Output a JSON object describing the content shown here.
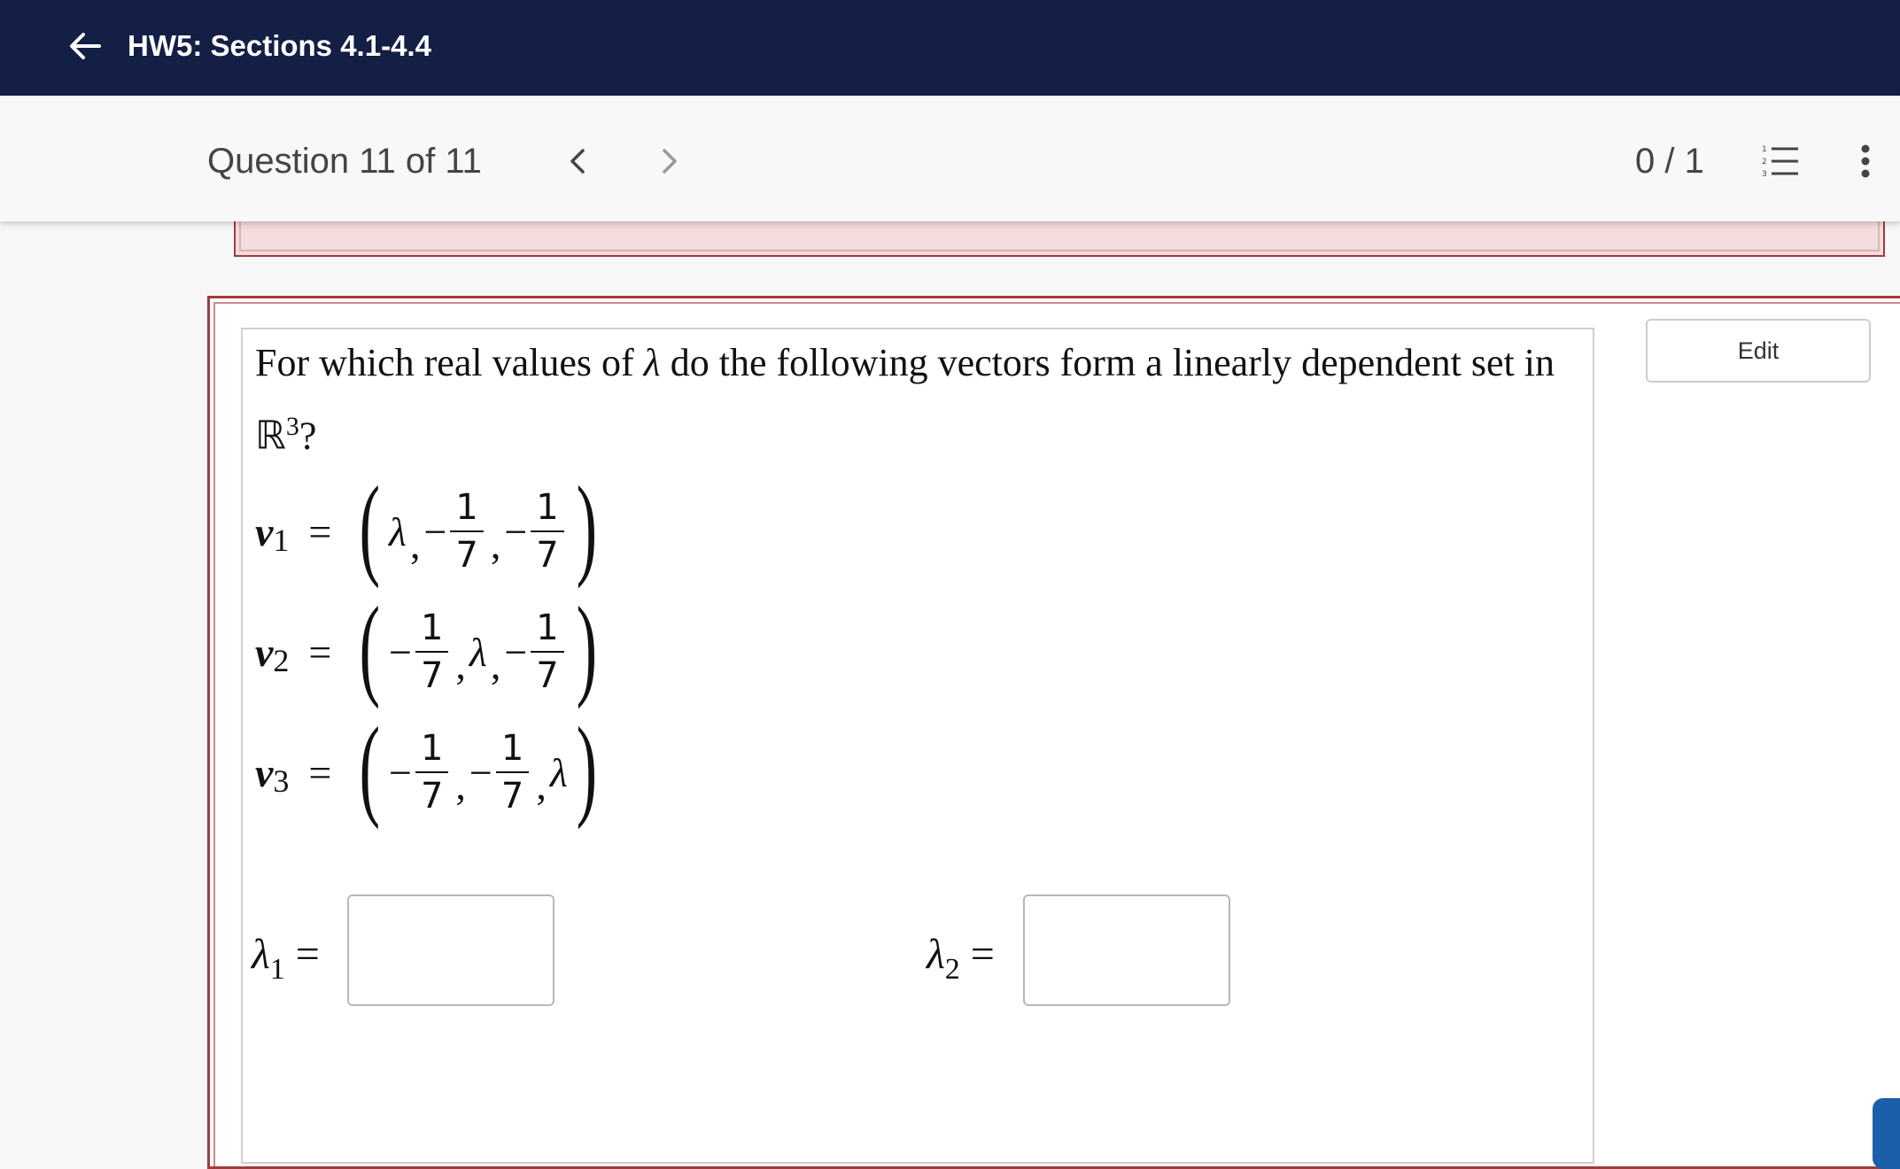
{
  "header": {
    "title": "HW5: Sections 4.1-4.4",
    "icon": "arrow-left-icon",
    "bg_color": "#141f45"
  },
  "question_bar": {
    "position_label": "Question 11 of 11",
    "score": "0 / 1",
    "icons": [
      "chevron-left-icon",
      "chevron-right-icon",
      "numbered-list-icon",
      "more-vertical-icon"
    ]
  },
  "question": {
    "edit_label": "Edit",
    "prompt_part1": "For which real values of ",
    "lambda": "λ",
    "prompt_part2": " do the following vectors form a linearly dependent set in ",
    "space": "ℝ",
    "space_exp": "3",
    "prompt_end": "?",
    "vectors": [
      {
        "name": "v",
        "sub": "1"
      },
      {
        "name": "v",
        "sub": "2"
      },
      {
        "name": "v",
        "sub": "3"
      }
    ],
    "minus": "−",
    "frac_num": "1",
    "frac_den": "7",
    "answers": [
      {
        "label": "λ",
        "sub": "1",
        "eq": "=",
        "value": ""
      },
      {
        "label": "λ",
        "sub": "2",
        "eq": "=",
        "value": ""
      }
    ]
  },
  "colors": {
    "error_border": "#a23b3b",
    "error_bg": "#f5dcdc"
  }
}
